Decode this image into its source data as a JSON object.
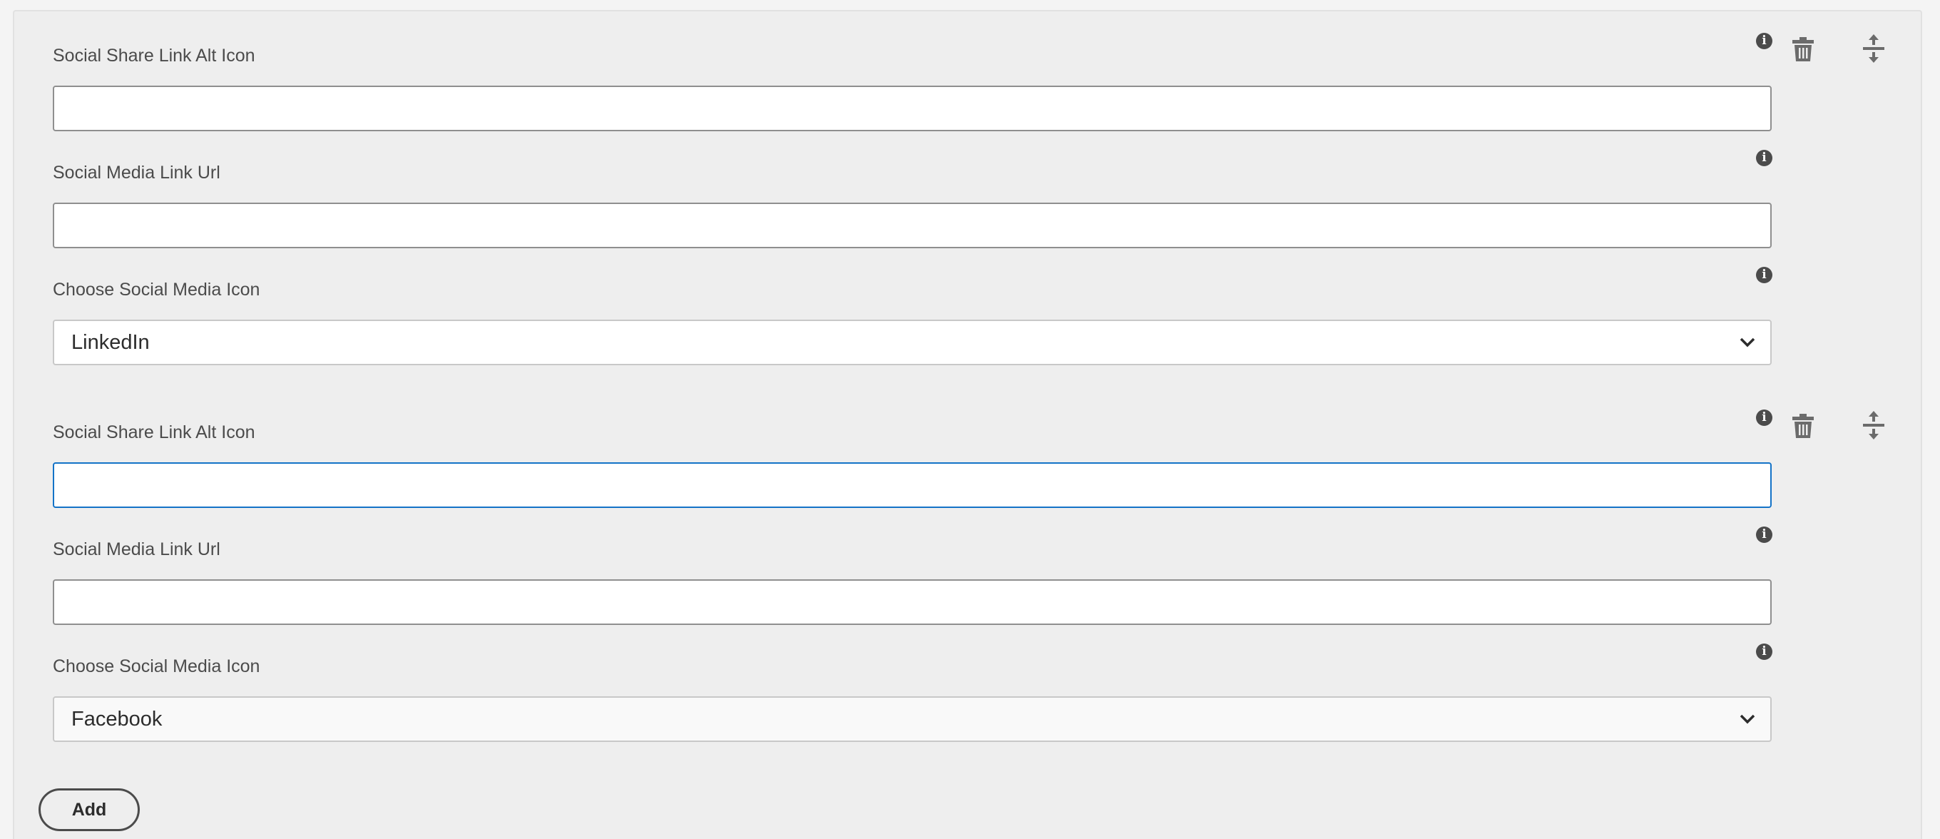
{
  "items": [
    {
      "alt_icon": {
        "label": "Social Share Link Alt Icon",
        "value": ""
      },
      "link_url": {
        "label": "Social Media Link Url",
        "value": ""
      },
      "icon_select": {
        "label": "Choose Social Media Icon",
        "selected": "LinkedIn"
      }
    },
    {
      "alt_icon": {
        "label": "Social Share Link Alt Icon",
        "value": ""
      },
      "link_url": {
        "label": "Social Media Link Url",
        "value": ""
      },
      "icon_select": {
        "label": "Choose Social Media Icon",
        "selected": "Facebook"
      }
    }
  ],
  "info_glyph": "i",
  "add_label": "Add",
  "icons": {
    "info": "info-icon",
    "delete": "trash-icon",
    "reorder": "move-icon",
    "dropdown": "chevron-down-icon"
  },
  "colors": {
    "focus_border": "#1473c7",
    "icon": "#4b4b4b"
  }
}
